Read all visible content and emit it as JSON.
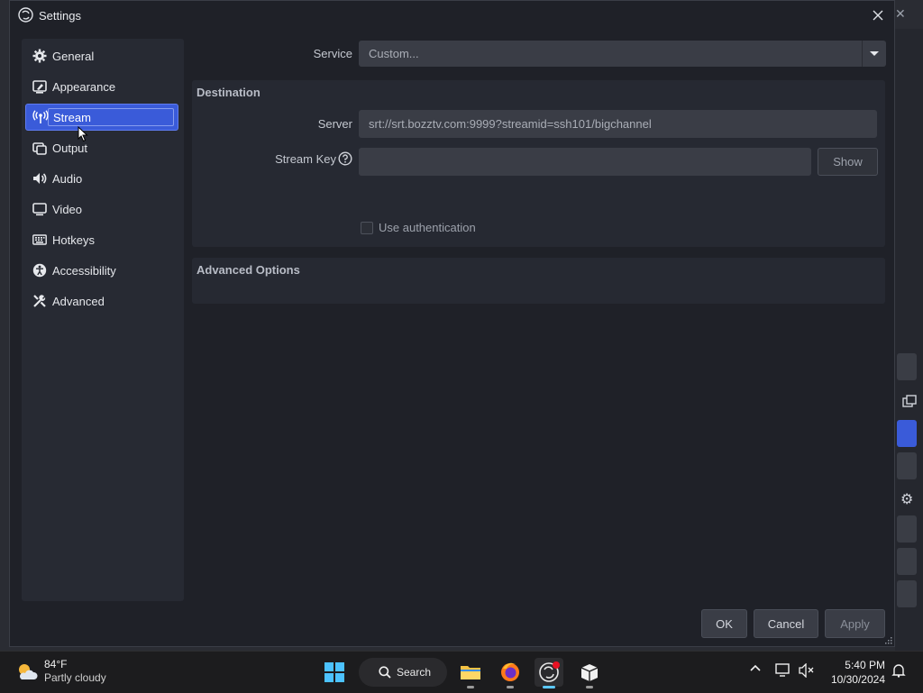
{
  "dialog": {
    "title": "Settings"
  },
  "sidebar": {
    "items": [
      {
        "label": "General",
        "icon": "gear-icon"
      },
      {
        "label": "Appearance",
        "icon": "appearance-icon"
      },
      {
        "label": "Stream",
        "icon": "broadcast-icon",
        "active": true
      },
      {
        "label": "Output",
        "icon": "output-icon"
      },
      {
        "label": "Audio",
        "icon": "speaker-icon"
      },
      {
        "label": "Video",
        "icon": "monitor-icon"
      },
      {
        "label": "Hotkeys",
        "icon": "keyboard-icon"
      },
      {
        "label": "Accessibility",
        "icon": "accessibility-icon"
      },
      {
        "label": "Advanced",
        "icon": "tools-icon"
      }
    ]
  },
  "stream": {
    "service_label": "Service",
    "service_value": "Custom...",
    "destination_title": "Destination",
    "server_label": "Server",
    "server_value": "srt://srt.bozztv.com:9999?streamid=ssh101/bigchannel",
    "stream_key_label": "Stream Key",
    "stream_key_value": "",
    "show_button": "Show",
    "use_auth_label": "Use authentication",
    "use_auth_checked": false,
    "advanced_title": "Advanced Options"
  },
  "footer": {
    "ok": "OK",
    "cancel": "Cancel",
    "apply": "Apply"
  },
  "taskbar": {
    "weather_temp": "84°F",
    "weather_desc": "Partly cloudy",
    "search_label": "Search",
    "time": "5:40 PM",
    "date": "10/30/2024"
  },
  "colors": {
    "accent": "#3a5bd9",
    "dialog_bg": "#1f2128",
    "panel_bg": "#262932",
    "field_bg": "#3a3d46"
  }
}
